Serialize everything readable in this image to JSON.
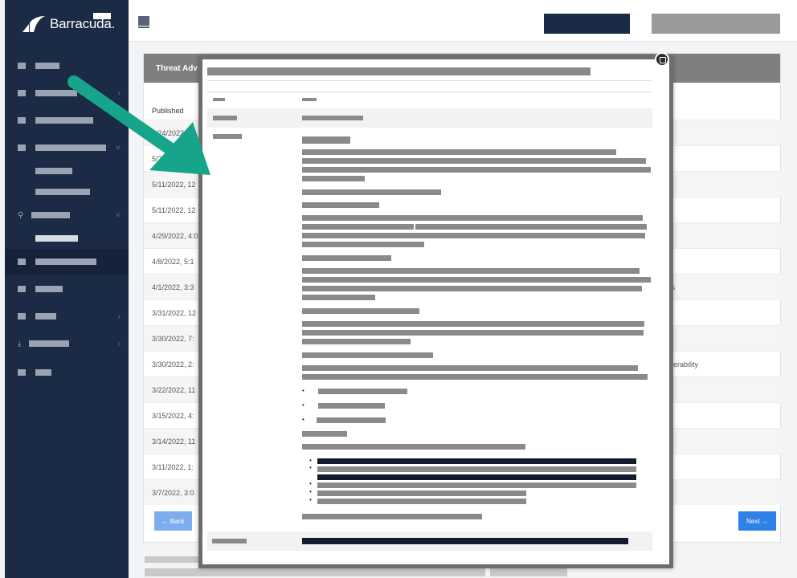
{
  "brand": {
    "name": "Barracuda."
  },
  "card": {
    "header_title": "Threat Adv",
    "column_published": "Published",
    "rows": [
      {
        "date": "5/24/2022, 11",
        "right": ""
      },
      {
        "date": "5/2",
        "right": ""
      },
      {
        "date": "5/11/2022, 12",
        "right": ""
      },
      {
        "date": "5/11/2022, 12",
        "right": ""
      },
      {
        "date": "4/29/2022, 4:0",
        "right": ""
      },
      {
        "date": "4/8/2022, 5:1",
        "right": ""
      },
      {
        "date": "4/1/2022, 3:3",
        "right": "ks"
      },
      {
        "date": "3/31/2022, 12",
        "right": ""
      },
      {
        "date": "3/30/2022, 7:",
        "right": ""
      },
      {
        "date": "3/30/2022, 2:",
        "right": "lnerability"
      },
      {
        "date": "3/22/2022, 11",
        "right": ""
      },
      {
        "date": "3/15/2022, 4:",
        "right": ""
      },
      {
        "date": "3/14/2022, 11",
        "right": ""
      },
      {
        "date": "3/11/2022, 1:",
        "right": ""
      },
      {
        "date": "3/7/2022, 3:0",
        "right": ""
      }
    ],
    "back_label": "← Back",
    "next_label": "Next →"
  },
  "annotation": {
    "arrow_color": "#16a58a"
  }
}
